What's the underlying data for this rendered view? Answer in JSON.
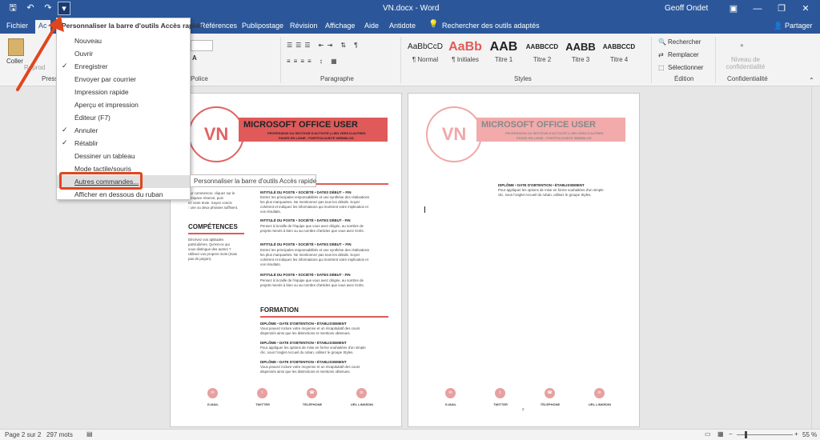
{
  "titlebar": {
    "doc_title": "VN.docx - Word",
    "user": "Geoff Ondet",
    "qat_dropdown_glyph": "▾"
  },
  "tabs": {
    "file": "Fichier",
    "home_partial": "Ac",
    "items": [
      "Références",
      "Publipostage",
      "Révision",
      "Affichage",
      "Aide",
      "Antidote"
    ],
    "tell_me": "Rechercher des outils adaptés",
    "share": "Partager"
  },
  "ribbon": {
    "paste": "Coller",
    "clipboard_partial": "Presse",
    "repro_partial": "Reprod",
    "font_label": "Police",
    "paragraph_label": "Paragraphe",
    "styles_label": "Styles",
    "editing_label": "Édition",
    "confidential_label": "Confidentialité",
    "styles": [
      {
        "preview": "AaBbCcD",
        "name": "¶ Normal"
      },
      {
        "preview": "AaBb",
        "name": "¶ Initiales"
      },
      {
        "preview": "AAB",
        "name": "Titre 1"
      },
      {
        "preview": "AABBCCD",
        "name": "Titre 2"
      },
      {
        "preview": "AABB",
        "name": "Titre 3"
      },
      {
        "preview": "AABBCCD",
        "name": "Titre 4"
      }
    ],
    "search": "Rechercher",
    "replace": "Remplacer",
    "select": "Sélectionner",
    "confidential_level": "Niveau de confidentialité"
  },
  "menu": {
    "title": "Personnaliser la barre d'outils Accès rapide",
    "items": [
      {
        "label": "Nouveau",
        "checked": false
      },
      {
        "label": "Ouvrir",
        "checked": false
      },
      {
        "label": "Enregistrer",
        "checked": true
      },
      {
        "label": "Envoyer par courrier",
        "checked": false
      },
      {
        "label": "Impression rapide",
        "checked": false
      },
      {
        "label": "Aperçu et impression",
        "checked": false
      },
      {
        "label": "Éditeur (F7)",
        "checked": false
      },
      {
        "label": "Annuler",
        "checked": true
      },
      {
        "label": "Rétablir",
        "checked": true
      },
      {
        "label": "Dessiner un tableau",
        "checked": false
      },
      {
        "label": "Mode tactile/souris",
        "checked": false
      },
      {
        "label": "Autres commandes...",
        "checked": false
      },
      {
        "label": "Afficher en dessous du ruban",
        "checked": false
      }
    ],
    "tooltip": "Personnaliser la barre d'outils Accès rapide"
  },
  "page1": {
    "initials": "VN",
    "name": "MICROSOFT OFFICE USER",
    "subline1": "PROFESSION OU SECTEUR D'ACTIVITÉ | LIEN VERS D'AUTRES",
    "subline2": "PAGES EN LIGNE : PORTFOLIO/SITE WEB/BLOG",
    "left_text": [
      "our commencer, cliquez sur le",
      "d'espace réservé, puis",
      "ez votre texte. Soyez concis",
      ": une ou deux phrases suffisent."
    ],
    "competences_title": "COMPÉTENCES",
    "competences_text": [
      "Décrivez vos aptitudes",
      "particulières. Qu'est-ce qui",
      "vous distingue des autres ?",
      "Utilisez vos propres mots (mais",
      "pas de jargon)."
    ],
    "jobs": [
      {
        "head": "INTITULÉ DU POSTE • SOCIÉTÉ • DATES DÉBUT – FIN",
        "lines": [
          "Entrez les principales responsabilités et une synthèse des réalisations",
          "les plus marquantes. Ne mentionnez pas tous les détails. Soyez",
          "cohérent et indiquez les informations qui montrent votre implication et",
          "vos résultats."
        ]
      },
      {
        "head": "INTITULÉ DU POSTE • SOCIÉTÉ • DATES DÉBUT - FIN",
        "lines": [
          "Pensez à la taille de l'équipe que vous avez dirigée, au nombre de",
          "projets menés à bien ou au nombre d'articles que vous avez écrits."
        ]
      },
      {
        "head": "INTITULÉ DU POSTE • SOCIÉTÉ • DATES DÉBUT – FIN",
        "lines": [
          "Entrez les principales responsabilités et une synthèse des réalisations",
          "les plus marquantes. Ne mentionnez pas tous les détails. Soyez",
          "cohérent et indiquez les informations qui montrent votre implication et",
          "vos résultats."
        ]
      },
      {
        "head": "INTITULÉ DU POSTE • SOCIÉTÉ • DATES DÉBUT - FIN",
        "lines": [
          "Pensez à la taille de l'équipe que vous avez dirigée, au nombre de",
          "projets menés à bien ou au nombre d'articles que vous avez écrits."
        ]
      }
    ],
    "formation_title": "FORMATION",
    "formations": [
      {
        "head": "DIPLÔME • DATE D'OBTENTION • ÉTABLISSEMENT",
        "lines": [
          "Vous pouvez inclure votre moyenne et un récapitulatif des cours",
          "dispensés ainsi que les distinctions et mentions obtenues."
        ]
      },
      {
        "head": "DIPLÔME • DATE D'OBTENTION • ÉTABLISSEMENT",
        "lines": [
          "Pour appliquer les options de mise en forme souhaitées d'un simple",
          "clic, sous l'onglet Accueil du ruban, utilisez le groupe Styles."
        ]
      },
      {
        "head": "DIPLÔME • DATE D'OBTENTION • ÉTABLISSEMENT",
        "lines": [
          "Vous pouvez inclure votre moyenne et un récapitulatif des cours",
          "dispensés ainsi que les distinctions et mentions obtenues."
        ]
      }
    ],
    "footer": [
      "E-MAIL",
      "TWITTER",
      "TÉLÉPHONE",
      "URL LINKEDIN"
    ]
  },
  "page2": {
    "initials": "VN",
    "name": "MICROSOFT OFFICE USER",
    "subline1": "PROFESSION OU SECTEUR D'ACTIVITÉ | LIEN VERS D'AUTRES",
    "subline2": "PAGES EN LIGNE : PORTFOLIO/SITE WEB/BLOG",
    "formation_head": "DIPLÔME • DATE D'OBTENTION • ÉTABLISSEMENT",
    "formation_lines": [
      "Pour appliquer les options de mise en forme souhaitées d'un simple",
      "clic, sous l'onglet Accueil du ruban, utilisez le groupe Styles."
    ],
    "footer": [
      "E-MAIL",
      "TWITTER",
      "TÉLÉPHONE",
      "URL LINKEDIN"
    ],
    "page_number": "2"
  },
  "status": {
    "page": "Page 2 sur 2",
    "words": "297 mots",
    "zoom": "55 %"
  },
  "colors": {
    "accent": "#2b579a",
    "resume_red": "#e05a5a",
    "highlight_red": "#e0461e"
  }
}
